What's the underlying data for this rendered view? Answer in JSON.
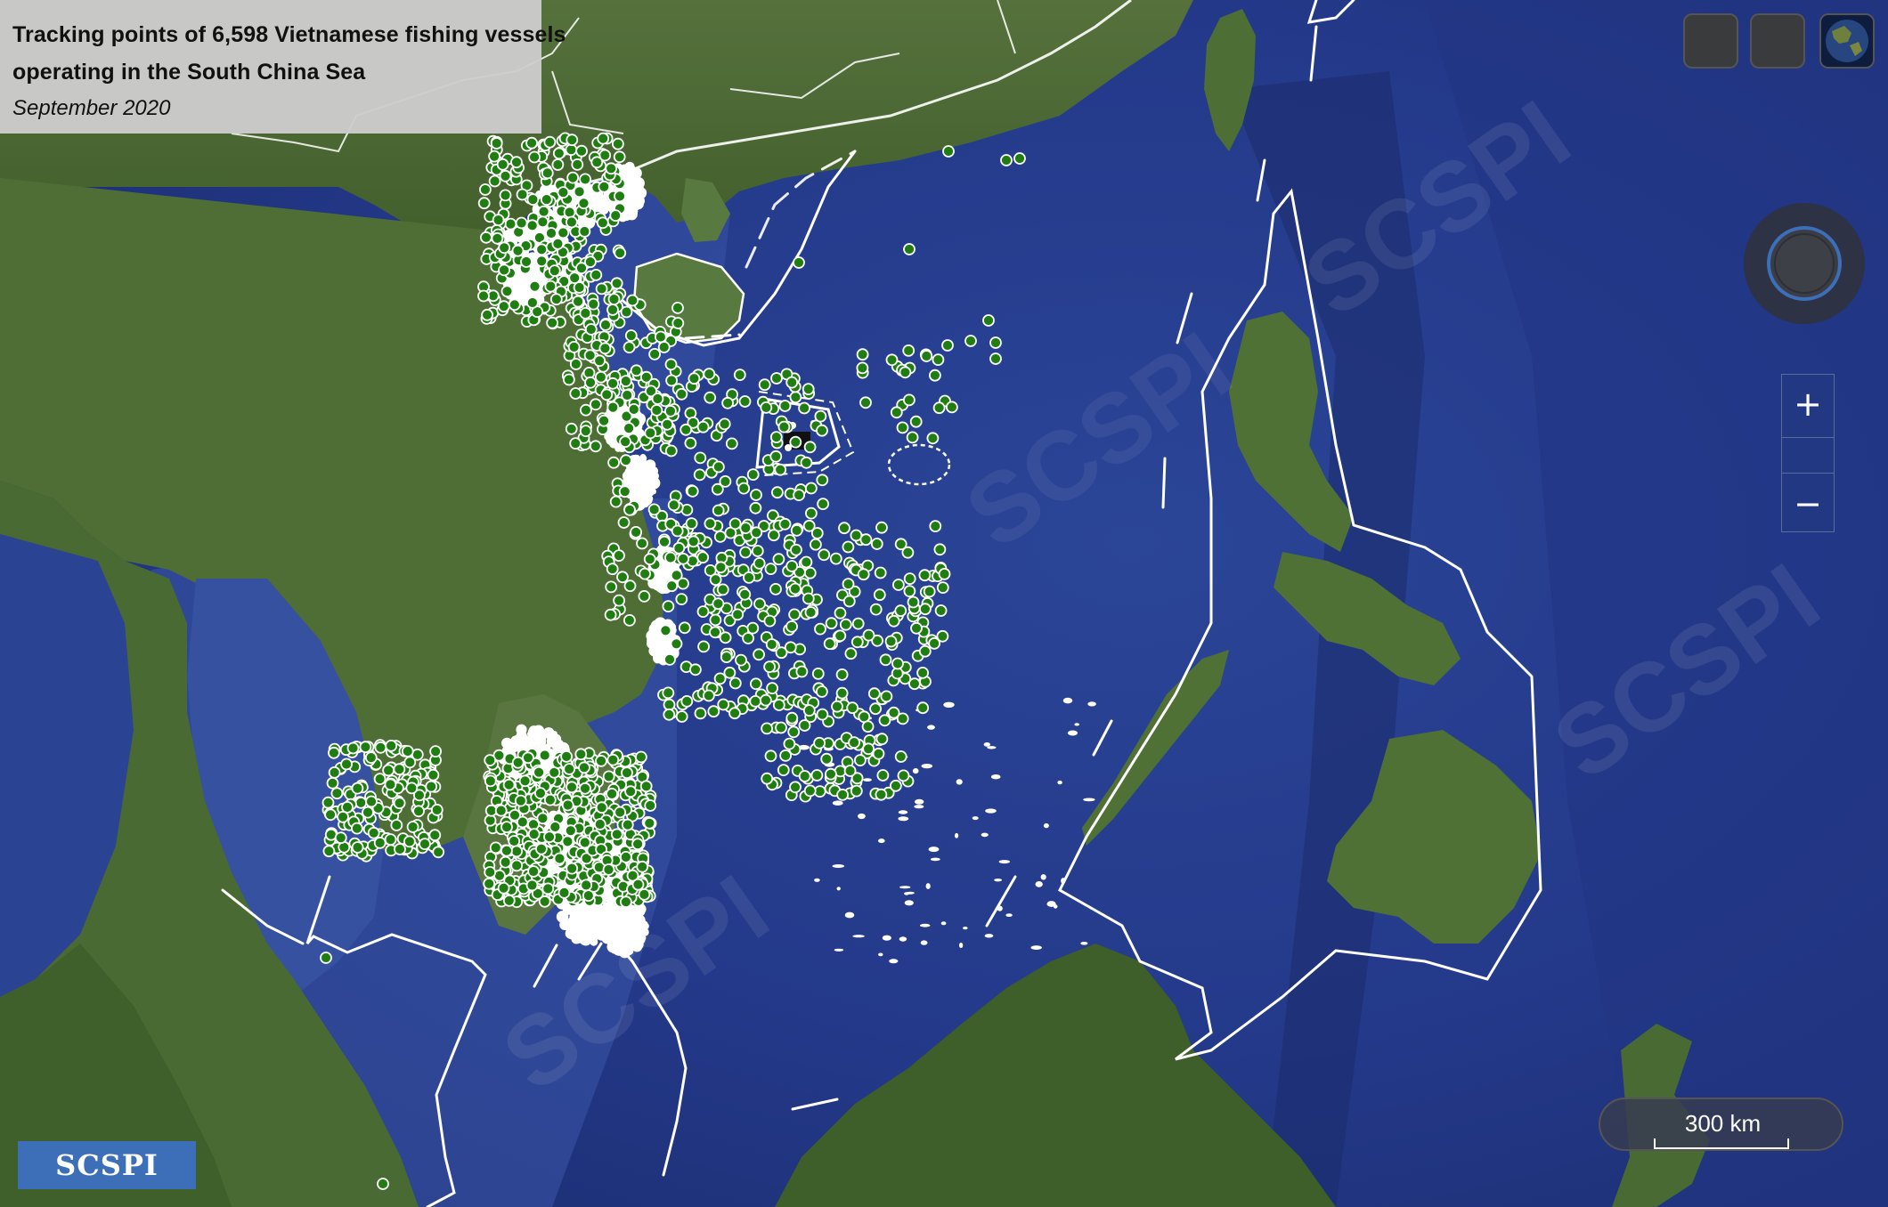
{
  "header": {
    "title_line1": "Tracking points of 6,598 Vietnamese fishing vessels",
    "title_line2": "operating in the South China Sea",
    "subtitle": "September 2020"
  },
  "controls": {
    "zoom_in": "+",
    "zoom_out": "−",
    "layer_buttons": [
      "basemap-button",
      "terrain-button"
    ],
    "scale_label": "300 km"
  },
  "logo": {
    "text": "SCSPI"
  },
  "watermark": {
    "text": "SCSPI"
  },
  "legend": {
    "vessel_point": "green dot, white outline",
    "dense_track_color": "#ffffff",
    "boundary_line_color": "#ffffff"
  },
  "colors": {
    "ocean": "#2d448f",
    "deep_ocean": "#1f3577",
    "land": "#4d6b34",
    "vessel_fill": "#1f7d12",
    "title_bg": "#cdcdcd",
    "logo_bg": "#3c6fb8"
  },
  "map": {
    "region": "South China Sea",
    "features": [
      "Vietnam coast",
      "Hainan",
      "Taiwan",
      "Philippines",
      "Borneo",
      "Malay Peninsula",
      "Paracel Islands",
      "Spratly Islands",
      "nine-dash line"
    ]
  }
}
